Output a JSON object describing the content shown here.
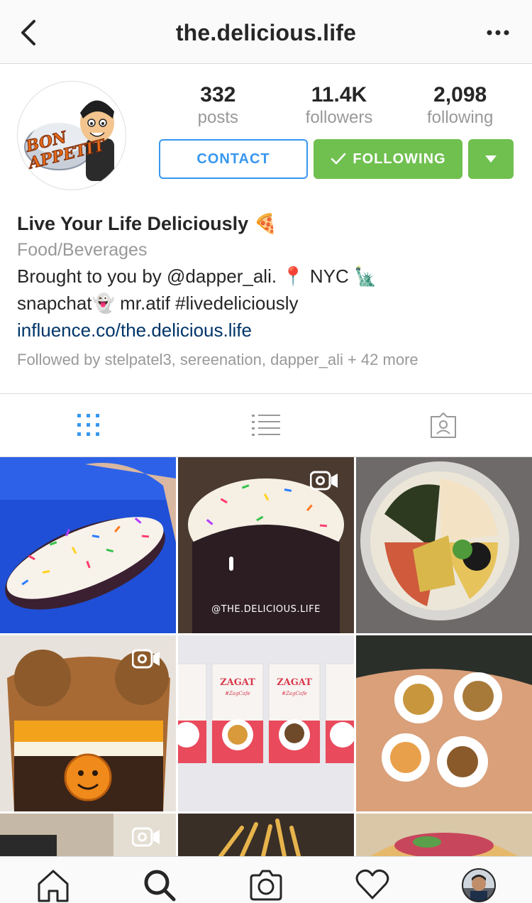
{
  "header": {
    "title": "the.delicious.life"
  },
  "profile": {
    "stats": [
      {
        "value": "332",
        "label": "posts"
      },
      {
        "value": "11.4K",
        "label": "followers"
      },
      {
        "value": "2,098",
        "label": "following"
      }
    ],
    "buttons": {
      "contact": "CONTACT",
      "following": "FOLLOWING"
    },
    "avatar_text": "BON APPETIT",
    "bio": {
      "name": "Live Your Life Deliciously 🍕",
      "category": "Food/Beverages",
      "line1": "Brought to you by @dapper_ali. 📍 NYC 🗽",
      "line2": "snapchat👻 mr.atif #livedeliciously",
      "link": "influence.co/the.delicious.life",
      "followed_by": "Followed by stelpatel3, sereenation, dapper_ali + 42 more"
    }
  },
  "tabs": [
    {
      "icon": "grid-icon",
      "active": true
    },
    {
      "icon": "list-icon",
      "active": false
    },
    {
      "icon": "tagged-icon",
      "active": false
    }
  ],
  "grid": {
    "watermark": "@THE.DELICIOUS.LIFE",
    "zagat_label": "ZAGAT",
    "zagat_sub": "#ZagCafe"
  },
  "colors": {
    "accent_blue": "#3897f0",
    "following_green": "#70c050",
    "link": "#003569",
    "muted": "#999999"
  },
  "bottom_nav": [
    "home-icon",
    "search-icon",
    "camera-icon",
    "heart-icon",
    "profile-avatar"
  ]
}
